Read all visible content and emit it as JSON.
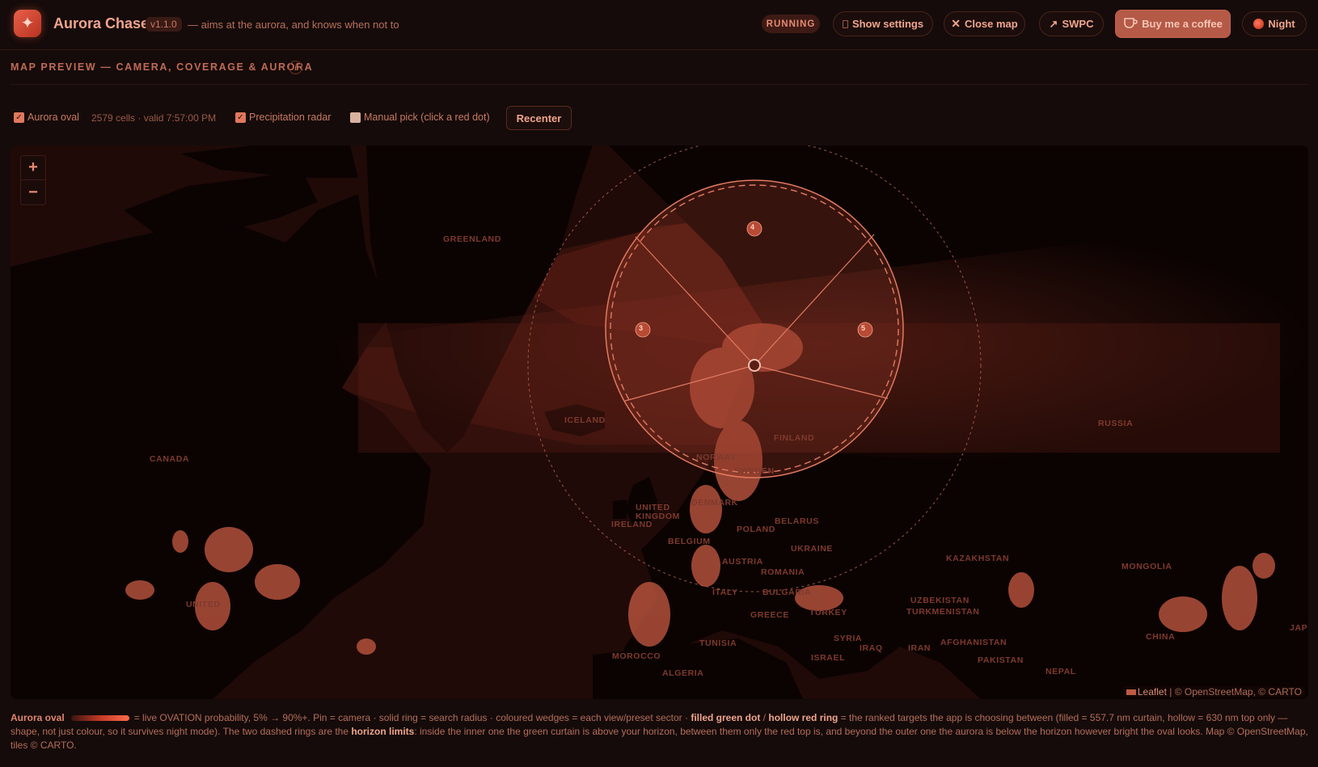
{
  "header": {
    "logo_glyph": "✦",
    "title": "Aurora Chaser",
    "version": "v1.1.0",
    "tagline": "— aims at the aurora, and knows when not to",
    "status": "RUNNING",
    "buttons": {
      "settings": "Show settings",
      "close_map": "Close map",
      "swpc": "SWPC",
      "coffee": "Buy me a coffee",
      "night": "Night"
    }
  },
  "section": {
    "title": "MAP PREVIEW — CAMERA, COVERAGE & AURORA",
    "info": "i"
  },
  "controls": {
    "aurora_oval": {
      "label": "Aurora oval",
      "checked": true
    },
    "cells_info": "2579 cells · valid 7:57:00 PM",
    "precipitation": {
      "label": "Precipitation radar",
      "checked": true
    },
    "manual_pick": {
      "label": "Manual pick (click a red dot)",
      "checked": false
    },
    "recenter": "Recenter"
  },
  "map": {
    "zoom_in": "+",
    "zoom_out": "−",
    "sector_labels": [
      "4",
      "3",
      "5"
    ],
    "countries": [
      "GREENLAND",
      "ICELAND",
      "CANADA",
      "RUSSIA",
      "UNITED KINGDOM",
      "IRELAND",
      "DENMARK",
      "POLAND",
      "BELARUS",
      "UKRAINE",
      "BELGIUM",
      "AUSTRIA",
      "ROMANIA",
      "ITALY",
      "BULGARIA",
      "GREECE",
      "TURKEY",
      "SYRIA",
      "IRAQ",
      "IRAN",
      "KAZAKHSTAN",
      "MONGOLIA",
      "UZBEKISTAN",
      "TURKMENISTAN",
      "AFGHANISTAN",
      "PAKISTAN",
      "CHINA",
      "TUNISIA",
      "MOROCCO",
      "ALGERIA",
      "ISRAEL",
      "UNITED",
      "NEPAL",
      "JAP",
      "FINLAND",
      "NORWAY",
      "SWEDEN"
    ],
    "attribution_leaflet": "Leaflet",
    "attribution_rest": " | © OpenStreetMap, © CARTO"
  },
  "legend": {
    "key": "Aurora oval",
    "text1": "= live OVATION probability, 5% → 90%+. Pin = camera · solid ring = search radius · coloured wedges = each view/preset sector · ",
    "filled": "filled green dot",
    "slash": " / ",
    "hollow": "hollow red ring",
    "text2": " = the ranked targets the app is choosing between (filled = 557.7 nm curtain, hollow = 630 nm top only — shape, not just colour, so it survives night mode). The two dashed rings are the ",
    "horizon": "horizon limits",
    "text3": ": inside the inner one the green curtain is above your horizon, between them only the red top is, and beyond the outer one the aurora is below the horizon however bright the oval looks. Map © OpenStreetMap, tiles © CARTO."
  },
  "colors": {
    "background": "#150b0a",
    "accent": "#e8604a",
    "text": "#e58a72",
    "map_land": "#0c0403",
    "map_sea": "#1d0907",
    "aurora": "#7a2a1e"
  },
  "icons": [
    "star-logo-icon",
    "gear-icon",
    "close-icon",
    "external-link-icon",
    "coffee-cup-icon",
    "moon-dot-icon",
    "info-icon"
  ]
}
